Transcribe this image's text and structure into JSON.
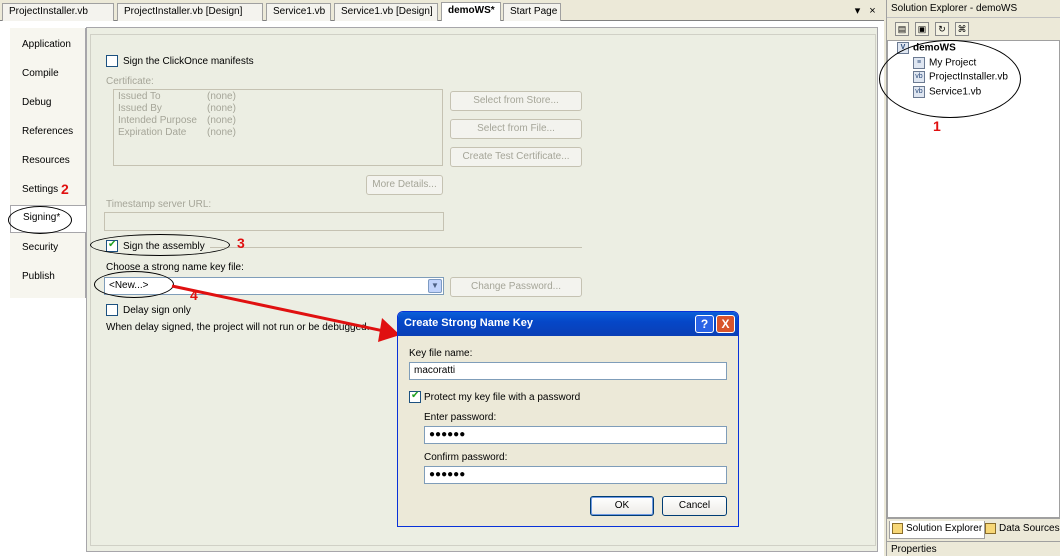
{
  "doc_tabs": [
    "ProjectInstaller.vb",
    "ProjectInstaller.vb [Design]",
    "Service1.vb",
    "Service1.vb [Design]",
    "demoWS*",
    "Start Page"
  ],
  "doc_tab_controls": {
    "dropdown": "▾",
    "close": "×"
  },
  "nav_items": [
    "Application",
    "Compile",
    "Debug",
    "References",
    "Resources",
    "Settings",
    "Signing*",
    "Security",
    "Publish"
  ],
  "signing": {
    "clickonce_label": "Sign the ClickOnce manifests",
    "certificate_label": "Certificate:",
    "cert_fields": [
      {
        "key": "Issued To",
        "value": "(none)"
      },
      {
        "key": "Issued By",
        "value": "(none)"
      },
      {
        "key": "Intended Purpose",
        "value": "(none)"
      },
      {
        "key": "Expiration Date",
        "value": "(none)"
      }
    ],
    "select_from_store": "Select from Store...",
    "select_from_file": "Select from File...",
    "create_test_cert": "Create Test Certificate...",
    "more_details": "More Details...",
    "timestamp_label": "Timestamp server URL:",
    "sign_assembly_label": "Sign the assembly",
    "choose_key_label": "Choose a strong name key file:",
    "key_file_value": "<New...>",
    "change_password": "Change Password...",
    "delay_sign_label": "Delay sign only",
    "delay_sign_note": "When delay signed, the project will not run or be debugged."
  },
  "annotations": {
    "n1": "1",
    "n2": "2",
    "n3": "3",
    "n4": "4"
  },
  "solution_explorer": {
    "title": "Solution Explorer - demoWS",
    "project": "demoWS",
    "items": [
      "My Project",
      "ProjectInstaller.vb",
      "Service1.vb"
    ],
    "tabs": [
      "Solution Explorer",
      "Data Sources"
    ],
    "properties_title": "Properties"
  },
  "dialog": {
    "title": "Create Strong Name Key",
    "help_label": "?",
    "close_label": "X",
    "key_file_name_label": "Key file name:",
    "key_file_name_value": "macoratti",
    "protect_label": "Protect my key file with a password",
    "enter_password_label": "Enter password:",
    "enter_password_value": "●●●●●●",
    "confirm_password_label": "Confirm password:",
    "confirm_password_value": "●●●●●●",
    "ok_label": "OK",
    "cancel_label": "Cancel"
  },
  "colors": {
    "annotation_red": "#e01010",
    "dialog_title_blue": "#0547c8"
  }
}
